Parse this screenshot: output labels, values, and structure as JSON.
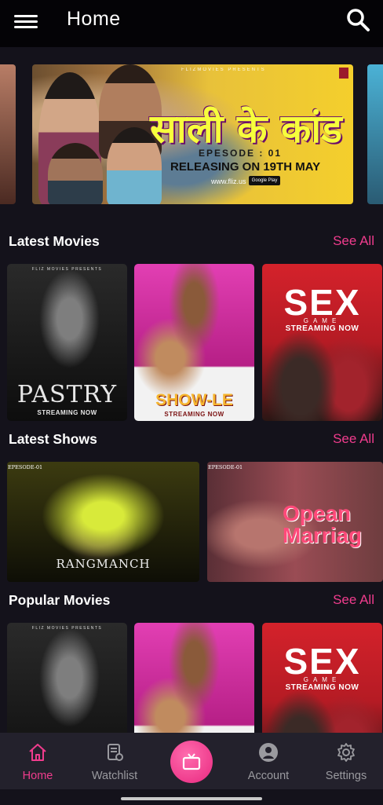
{
  "header": {
    "title": "Home",
    "menu_icon": "hamburger-icon",
    "search_icon": "search-icon"
  },
  "banner": {
    "presents": "FLIZMOVIES PRESENTS",
    "title": "साली के कांड",
    "episode": "EPESODE : 01",
    "release": "RELEASING ON 19TH MAY",
    "url": "www.fliz.us",
    "store": "Google Play"
  },
  "sections": {
    "latest_movies": {
      "label": "Latest Movies",
      "see_all": "See All"
    },
    "latest_shows": {
      "label": "Latest Shows",
      "see_all": "See All"
    },
    "popular_movies": {
      "label": "Popular Movies",
      "see_all": "See All"
    }
  },
  "latest_movies": [
    {
      "presents": "FLIZ MOVIES PRESENTS",
      "title": "PASTRY",
      "subtitle": "STREAMING NOW"
    },
    {
      "presents": "FLIZ MOVIES PRESENTS",
      "title": "SHOW-LE",
      "subtitle": "STREAMING NOW"
    },
    {
      "title": "SEX",
      "game": "GAME",
      "subtitle": "STREAMING NOW"
    }
  ],
  "latest_shows": [
    {
      "episode": "EPESODE-01",
      "title": "RANGMANCH"
    },
    {
      "episode": "EPESODE-01",
      "title": "Opean Marriag"
    }
  ],
  "popular_movies": [
    {
      "presents": "FLIZ MOVIES PRESENTS",
      "title": "",
      "subtitle": ""
    },
    {
      "title": "",
      "subtitle": ""
    },
    {
      "title": "SEX",
      "game": "GAME",
      "subtitle": "STREAMING NOW"
    }
  ],
  "navbar": {
    "home": "Home",
    "watchlist": "Watchlist",
    "account": "Account",
    "settings": "Settings"
  },
  "colors": {
    "accent": "#f03c8d",
    "background": "#14121b",
    "navbar": "#23212c"
  }
}
